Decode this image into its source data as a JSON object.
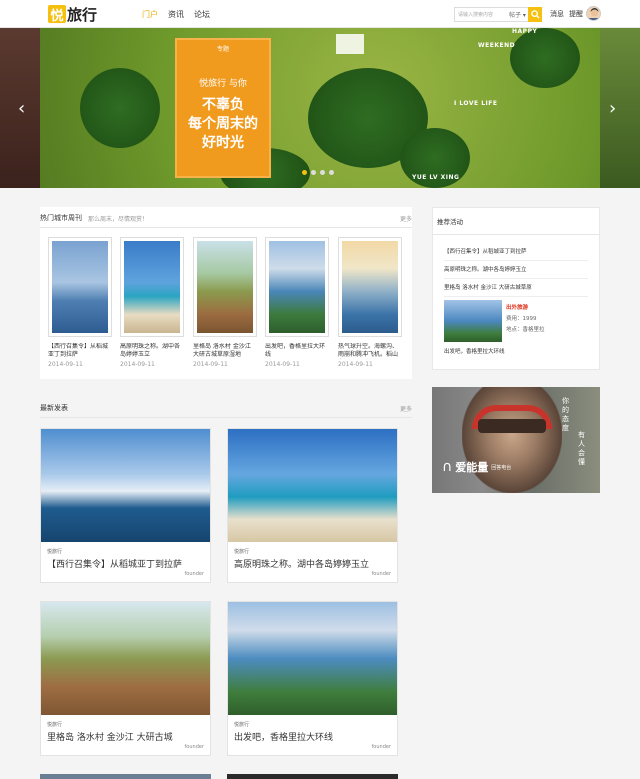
{
  "header": {
    "logo_mark": "悦",
    "logo_rest": "旅行",
    "nav": [
      "门户",
      "资讯",
      "论坛"
    ],
    "search": {
      "placeholder": "请输入搜索内容",
      "scope": "帖子"
    },
    "links": {
      "messages": "消息",
      "reminders": "提醒"
    }
  },
  "banner": {
    "card_tag": "专题",
    "card_sub": "悦旅行 与你",
    "card_line1": "不辜负",
    "card_line2": "每个周末的",
    "card_line3": "好时光",
    "text_happy": "HAPPY",
    "text_weekend": "WEEKEND",
    "text_love": "I LOVE LIFE",
    "text_yue": "YUE LV XING",
    "prev": "‹",
    "next": "›"
  },
  "hot_cities": {
    "title": "热门城市周刊",
    "subtitle": "那么周末，尽情观赏！",
    "more": "更多",
    "items": [
      {
        "title": "【西行召集令】从稻城亚丁到拉萨",
        "date": "2014-09-11"
      },
      {
        "title": "高原明珠之称。湖中各岛婷婷玉立",
        "date": "2014-09-11"
      },
      {
        "title": "里格岛 洛水村 金沙江 大研古城草原湿地",
        "date": "2014-09-11"
      },
      {
        "title": "出发吧，香格里拉大环线",
        "date": "2014-09-11"
      },
      {
        "title": "热气球升空。海螺沟、雨崩和腾冲飞机。稻山市",
        "date": "2014-09-11"
      }
    ]
  },
  "latest": {
    "title": "最新发表",
    "more": "更多",
    "posts": [
      {
        "category": "悦旅行",
        "title": "【西行召集令】从稻城亚丁到拉萨",
        "author": "founder"
      },
      {
        "category": "悦旅行",
        "title": "高原明珠之称。湖中各岛婷婷玉立",
        "author": "founder"
      },
      {
        "category": "悦旅行",
        "title": "里格岛 洛水村 金沙江 大研古城",
        "author": "founder"
      },
      {
        "category": "悦旅行",
        "title": "出发吧，香格里拉大环线",
        "author": "founder"
      }
    ]
  },
  "activities": {
    "title": "推荐活动",
    "items": [
      "【西行召集令】从稻城亚丁到拉萨",
      "高原明珠之称。湖中各岛婷婷玉立",
      "里格岛 洛水村 金沙江 大研古城草原"
    ],
    "feature": {
      "label": "出外旅游",
      "cost": "费用：1999",
      "place": "地点：香格里拉"
    },
    "last": "出发吧，香格里拉大环线"
  },
  "ad": {
    "brand": "爱能量",
    "brand_sub": "回答电台",
    "right1": "你的态度",
    "right2": "有人会懂"
  }
}
